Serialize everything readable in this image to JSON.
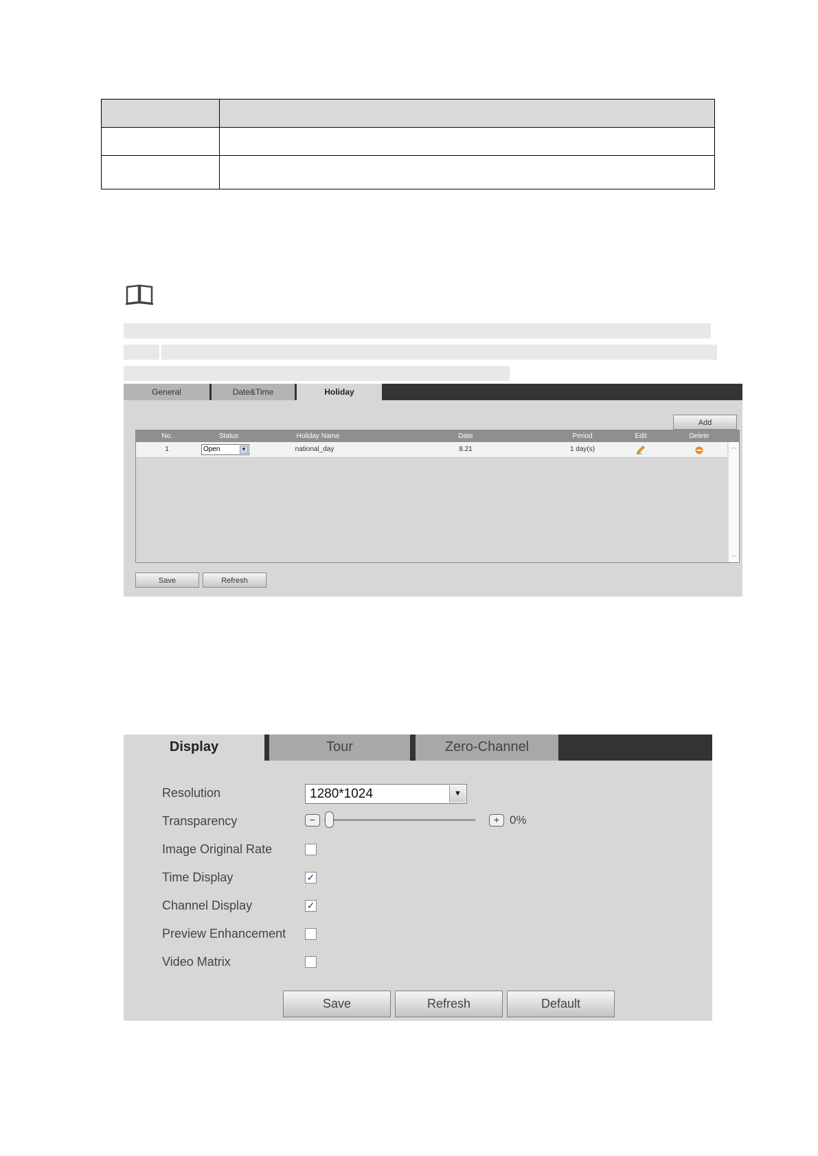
{
  "holiday_panel": {
    "tabs": [
      "General",
      "Date&Time",
      "Holiday"
    ],
    "add_label": "Add",
    "columns": [
      "No.",
      "Status",
      "Holiday Name",
      "Date",
      "Period",
      "Edit",
      "Delete"
    ],
    "rows": [
      {
        "no": "1",
        "status": "Open",
        "name": "national_day",
        "date": "8.21",
        "period": "1 day(s)"
      }
    ],
    "save_label": "Save",
    "refresh_label": "Refresh"
  },
  "display_panel": {
    "tabs": [
      "Display",
      "Tour",
      "Zero-Channel"
    ],
    "labels": {
      "resolution": "Resolution",
      "transparency": "Transparency",
      "image_original_rate": "Image Original Rate",
      "time_display": "Time Display",
      "channel_display": "Channel Display",
      "preview_enhancement": "Preview Enhancement",
      "video_matrix": "Video Matrix"
    },
    "resolution_value": "1280*1024",
    "transparency_value": "0%",
    "checks": {
      "image_original_rate": false,
      "time_display": true,
      "channel_display": true,
      "preview_enhancement": false,
      "video_matrix": false
    },
    "save_label": "Save",
    "refresh_label": "Refresh",
    "default_label": "Default"
  }
}
